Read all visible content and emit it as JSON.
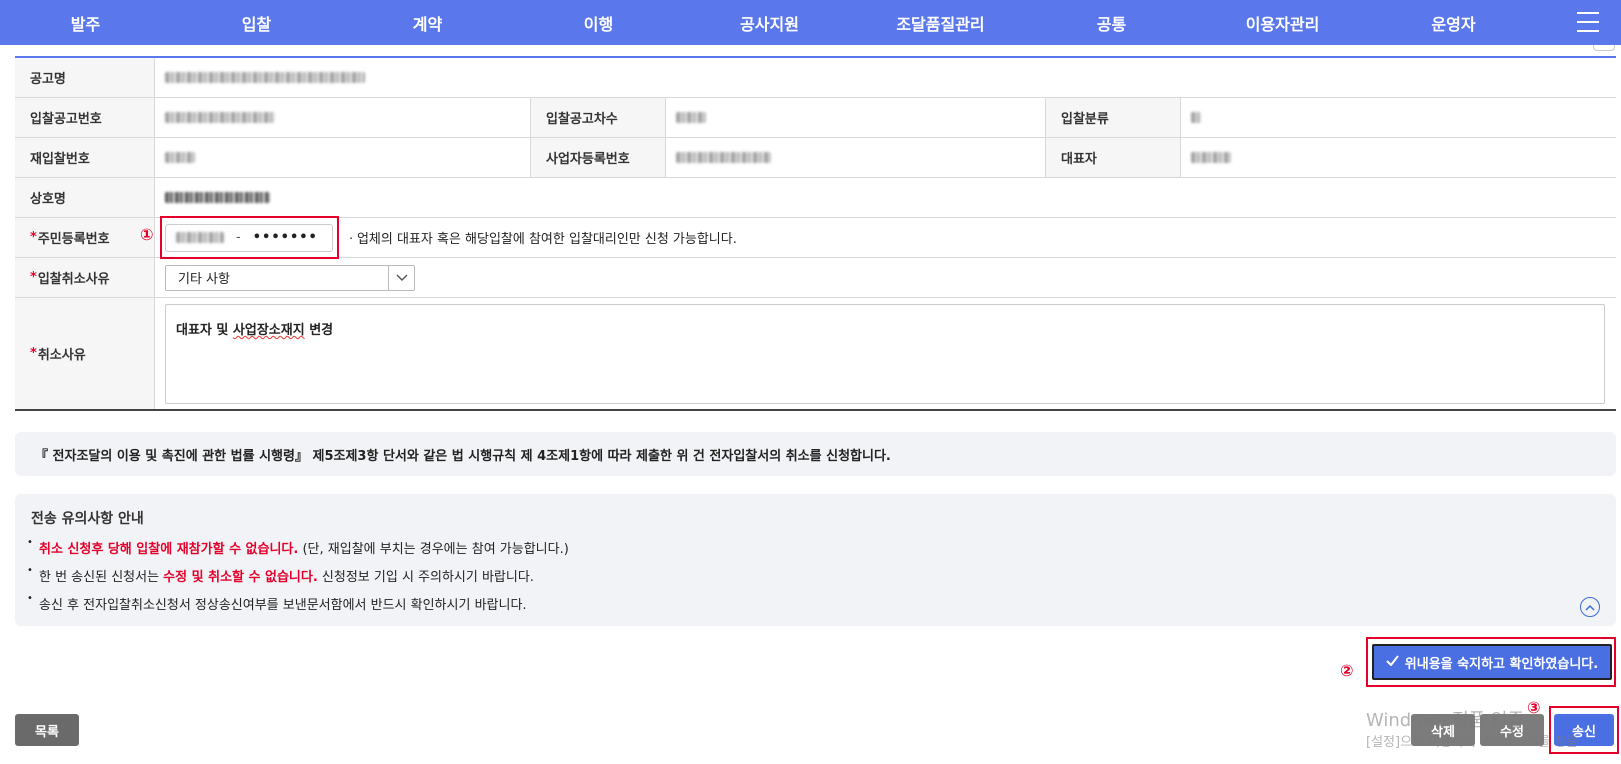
{
  "nav": {
    "items": [
      "발주",
      "입찰",
      "계약",
      "이행",
      "공사지원",
      "조달품질관리",
      "공통",
      "이용자관리",
      "운영자"
    ]
  },
  "form": {
    "labels": {
      "notice_name": "공고명",
      "bid_notice_no": "입찰공고번호",
      "bid_notice_seq": "입찰공고차수",
      "bid_type": "입찰분류",
      "rebid_no": "재입찰번호",
      "biz_reg_no": "사업자등록번호",
      "representative": "대표자",
      "company_name": "상호명",
      "rrn": "주민등록번호",
      "cancel_reason_type": "입찰취소사유",
      "cancel_reason": "취소사유"
    },
    "required_mark": "*",
    "rrn_dash": "-",
    "rrn_mask": "•••••••",
    "rrn_note": "ㆍ업체의 대표자 혹은 해당입찰에 참여한 입찰대리인만 신청 가능합니다.",
    "cancel_reason_select": "기타 사항",
    "cancel_reason_text_a": "대표자 및 ",
    "cancel_reason_text_b": "사업장소재지",
    "cancel_reason_text_c": " 변경"
  },
  "legal_text": "『 전자조달의 이용 및 촉진에 관한 법률 시행령』 제5조제3항 단서와 같은 법 시행규칙 제 4조제1항에 따라 제출한 위 건 전자입찰서의 취소를 신청합니다.",
  "notice": {
    "title": "전송 유의사항 안내",
    "item1_red": "취소 신청후 당해 입찰에 재참가할 수 없습니다.",
    "item1_rest": " (단, 재입찰에 부치는 경우에는 참여 가능합니다.)",
    "item2_pre": "한 번 송신된 신청서는 ",
    "item2_red": "수정 및 취소할 수 없습니다.",
    "item2_rest": " 신청정보 기입 시 주의하시기 바랍니다.",
    "item3": "송신 후 전자입찰취소신청서 정상송신여부를 보낸문서함에서 반드시 확인하시기 바랍니다."
  },
  "confirm_button": "위내용을 숙지하고 확인하였습니다.",
  "buttons": {
    "list": "목록",
    "delete": "삭제",
    "edit": "수정",
    "send": "송신"
  },
  "markers": {
    "m1": "①",
    "m2": "②",
    "m3": "③"
  },
  "watermark": {
    "line1": "Windows 정품 인증",
    "line2": "[설정]으로 이동하여 Windows를 정품"
  },
  "icons": {
    "menu": "hamburger-menu-icon",
    "check": "check-icon",
    "collapse": "chevron-up-icon",
    "select": "chevron-down-icon"
  },
  "colors": {
    "nav": "#5a78ec",
    "primary_button": "#4a6fe3",
    "required": "#e4002b",
    "highlight": "#e4002b"
  }
}
